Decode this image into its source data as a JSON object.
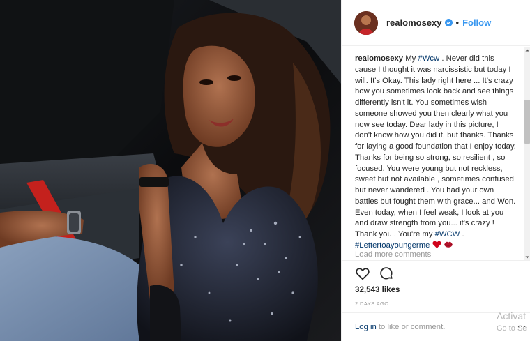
{
  "post": {
    "username": "realomosexy",
    "dot": "•",
    "follow_label": "Follow",
    "caption_user": "realomosexy",
    "caption_parts": [
      {
        "text": "My ",
        "kind": "text"
      },
      {
        "text": "#Wcw",
        "kind": "tag"
      },
      {
        "text": " . Never did this cause I thought it was narcissistic but today I will. It's Okay. This lady right here ... It's crazy how you sometimes look back and see things differently isn't it. You sometimes wish someone showed you then clearly what you now see today. Dear lady in this picture, I don't know how you did it, but thanks. Thanks for laying a good foundation that I enjoy today. Thanks for being so strong, so resilient , so focused. You were young but not reckless, sweet but not available , sometimes confused but never wandered . You had your own battles but fought them with grace... and Won. Even today, when I feel weak, I look at you and draw strength from you... it's crazy ! Thank you . You're my ",
        "kind": "text"
      },
      {
        "text": "#WCW",
        "kind": "tag"
      },
      {
        "text": " . ",
        "kind": "text"
      },
      {
        "text": "#Lettertoayoungerme",
        "kind": "tag"
      }
    ],
    "load_more": "Load more comments",
    "likes": "32,543 likes",
    "time": "2 DAYS AGO",
    "login_link": "Log in",
    "login_rest": " to like or comment.",
    "more_options": "...",
    "watermark_line1": "Activat",
    "watermark_line2": "Go to Se"
  },
  "icons": {
    "verified": "verified-badge-icon",
    "heart": "heart-outline-icon",
    "comment": "comment-bubble-icon",
    "emoji_heart": "red-heart-emoji",
    "emoji_lips": "kiss-lips-emoji"
  },
  "colors": {
    "link_blue": "#3897f0",
    "hashtag": "#003569",
    "muted": "#999999",
    "text": "#262626",
    "divider": "#efefef"
  }
}
